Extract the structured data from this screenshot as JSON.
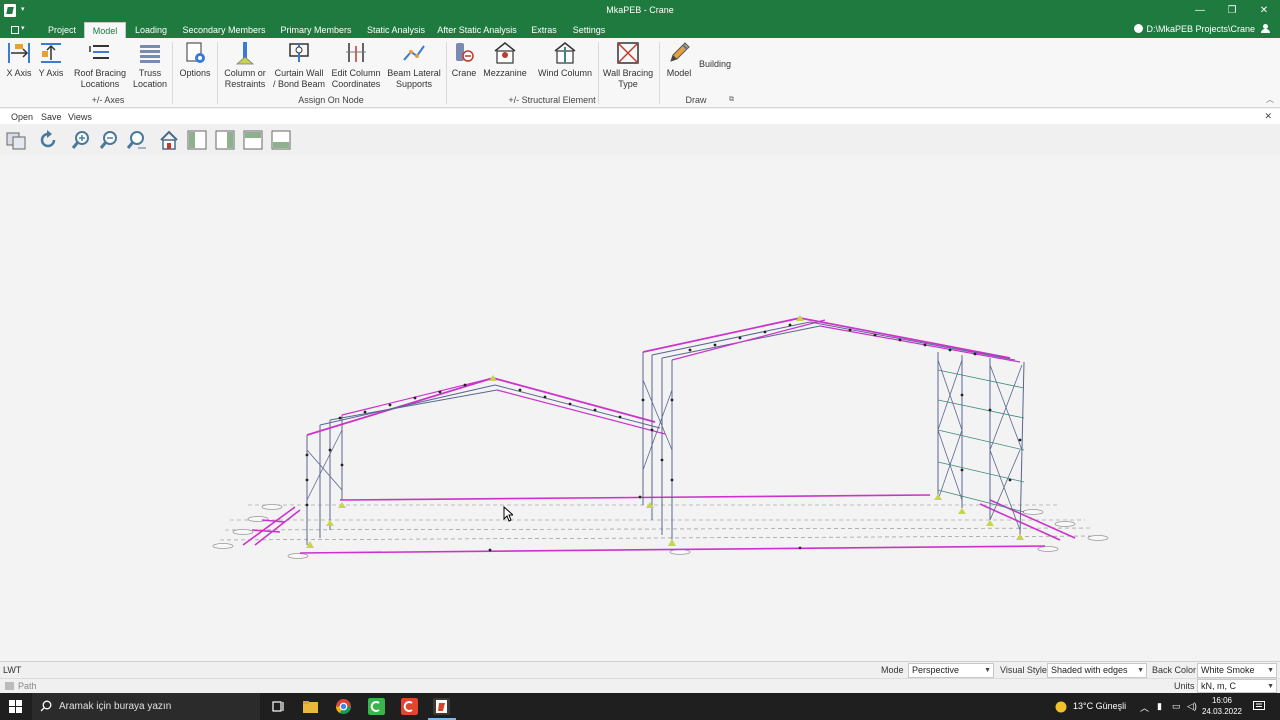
{
  "window": {
    "title": "MkaPEB - Crane",
    "project_path": "D:\\MkaPEB Projects\\Crane"
  },
  "tabs": [
    "Project",
    "Model",
    "Loading",
    "Secondary Members",
    "Primary Members",
    "Static Analysis",
    "After Static Analysis",
    "Extras",
    "Settings"
  ],
  "active_tab": "Model",
  "ribbon": {
    "x_axis": "X Axis",
    "y_axis": "Y Axis",
    "roof_bracing": [
      "Roof Bracing",
      "Locations"
    ],
    "truss": [
      "Truss",
      "Location"
    ],
    "options": "Options",
    "column": [
      "Column or",
      "Restraints"
    ],
    "curtain_wall": [
      "Curtain Wall",
      "/ Bond Beam"
    ],
    "edit_column": [
      "Edit Column",
      "Coordinates"
    ],
    "beam_lateral": [
      "Beam Lateral",
      "Supports"
    ],
    "crane": "Crane",
    "mezzanine": "Mezzanine",
    "wind_column": "Wind Column",
    "wall_bracing": [
      "Wall Bracing",
      "Type"
    ],
    "model": "Model",
    "building": "Building",
    "groups": {
      "axes": "+/-  Axes",
      "assign_on_node": "Assign On Node",
      "structural_element": "+/- Structural Element",
      "draw": "Draw"
    }
  },
  "submenu": [
    "Open",
    "Save",
    "Views"
  ],
  "status": {
    "lwt": "LWT",
    "mode_label": "Mode",
    "mode_value": "Perspective",
    "visual_style_label": "Visual Style",
    "visual_style_value": "Shaded with edges",
    "back_color_label": "Back Color",
    "back_color_value": "White Smoke",
    "units_label": "Units",
    "units_value": "kN, m, C",
    "path_label": "Path"
  },
  "taskbar": {
    "search_placeholder": "Aramak için buraya yazın",
    "weather": "13°C  Güneşli",
    "time": "16:06",
    "date": "24.03.2022"
  },
  "colors": {
    "title_green": "#1e7a3e",
    "frame_magenta": "#cc33cc",
    "frame_blue": "#5a6690",
    "bracing_teal": "#3a8a7a",
    "support_yellow": "#c8d44a"
  }
}
